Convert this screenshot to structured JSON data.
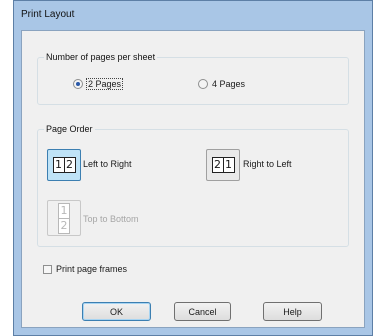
{
  "dialog": {
    "title": "Print Layout"
  },
  "pages_per_sheet": {
    "label": "Number of pages per sheet",
    "options": [
      {
        "label": "2 Pages",
        "selected": true
      },
      {
        "label": "4 Pages",
        "selected": false
      }
    ]
  },
  "page_order": {
    "label": "Page Order",
    "options": [
      {
        "label": "Left to Right",
        "icon_digits": [
          "1",
          "2"
        ],
        "selected": true,
        "enabled": true
      },
      {
        "label": "Right to Left",
        "icon_digits": [
          "2",
          "1"
        ],
        "selected": false,
        "enabled": true
      },
      {
        "label": "Top to Bottom",
        "icon_digits": [
          "1",
          "2"
        ],
        "selected": false,
        "enabled": false
      }
    ]
  },
  "print_page_frames": {
    "label": "Print page frames",
    "checked": false
  },
  "buttons": {
    "ok": "OK",
    "cancel": "Cancel",
    "help": "Help"
  }
}
